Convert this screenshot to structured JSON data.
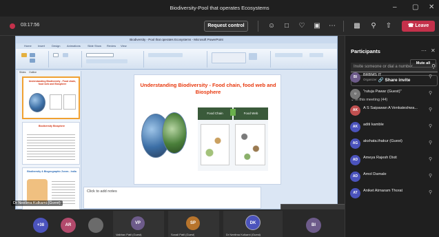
{
  "window": {
    "title": "Biodiversity-Pool that operates Ecosystems",
    "min": "–",
    "restore": "▢",
    "close": "✕"
  },
  "toolbar": {
    "timer": "03:17:56",
    "request_control": "Request control",
    "leave": "Leave",
    "icons": [
      "people-icon",
      "chat-icon",
      "reactions-icon",
      "rooms-icon",
      "more-icon",
      "camera-icon",
      "mic-icon",
      "share-icon"
    ]
  },
  "powerpoint": {
    "title": "Biodiversity - Pool that operates Ecosystems - Microsoft PowerPoint",
    "tabs": [
      "Home",
      "Insert",
      "Design",
      "Animations",
      "Slide Show",
      "Review",
      "View"
    ],
    "pane_tabs": [
      "Slides",
      "Outline"
    ],
    "thumbnails": [
      {
        "title": "Understanding Biodiversity - Food chain, food web and Biosphere"
      },
      {
        "title": "Biodiversity Biosphere"
      },
      {
        "title": "Biodiversity & Biogeographic Zones - India"
      }
    ],
    "slide": {
      "title": "Understanding  Biodiversity  - Food chain, food web and Biosphere",
      "label_food_chain": "Food Chain",
      "label_food_web": "Food Web"
    },
    "notes_placeholder": "Click to add notes"
  },
  "presenter_tag": "Dr Neelima Kulkarni (Guest)",
  "strip": [
    {
      "initials": "+38",
      "color": "#4b53bc"
    },
    {
      "initials": "AR",
      "color": "#b24a6c"
    },
    {
      "initials": "",
      "color": "#6b6b6b"
    },
    {
      "initials": "VP",
      "color": "#6d5b8a",
      "name": "Vaibhav Patil (Guest)"
    },
    {
      "initials": "SP",
      "color": "#b7742c",
      "name": "Sonali Patil (Guest)"
    },
    {
      "initials": "DK",
      "color": "#4b53bc",
      "name": "Dr Neelima Kulkarni (Guest)"
    },
    {
      "initials": "BI",
      "color": "#6d5b8a"
    }
  ],
  "panel": {
    "title": "Participants",
    "invite_placeholder": "Invite someone or dial a number",
    "share_invite": "Share invite",
    "section": "In this meeting (44)",
    "mute_all": "Mute all",
    "participants": [
      {
        "initials": "BI",
        "name": "BRBMS IT",
        "role": "Organizer",
        "color": "#6d5b8a"
      },
      {
        "initials": "",
        "name": "\"rutuja Pawar (Guest)\"",
        "role": "",
        "color": "#777777"
      },
      {
        "initials": "AK",
        "name": "A S Saipawan A Venkateshwa...",
        "role": "",
        "color": "#c05050"
      },
      {
        "initials": "AK",
        "name": "aditi kamble",
        "role": "",
        "color": "#4b53bc"
      },
      {
        "initials": "AG",
        "name": "akshata.thakur (Guest)",
        "role": "",
        "color": "#4b53bc"
      },
      {
        "initials": "AD",
        "name": "Ameya Rajesh Dixit",
        "role": "",
        "color": "#4b53bc"
      },
      {
        "initials": "AD",
        "name": "Amol Damale",
        "role": "",
        "color": "#4b53bc"
      },
      {
        "initials": "AT",
        "name": "Aniket Atmaram Thorat",
        "role": "",
        "color": "#4b53bc"
      }
    ]
  }
}
